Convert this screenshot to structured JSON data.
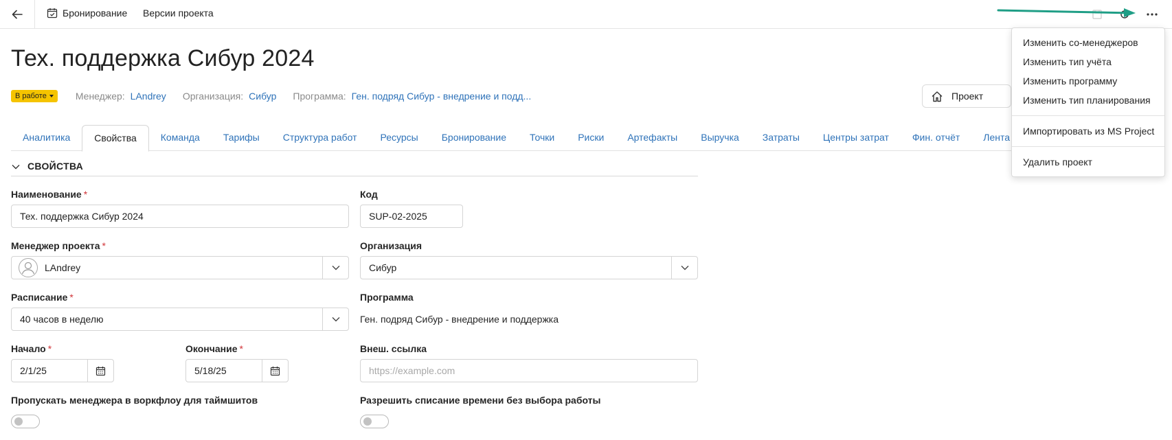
{
  "topbar": {
    "booking_label": "Бронирование",
    "versions_label": "Версии проекта"
  },
  "header": {
    "title": "Тех. поддержка Сибур 2024",
    "status_badge": "В работе",
    "manager_label": "Менеджер:",
    "manager_value": "LAndrey",
    "org_label": "Организация:",
    "org_value": "Сибур",
    "program_label": "Программа:",
    "program_value": "Ген. подряд Сибур - внедрение и подд...",
    "project_button": "Проект"
  },
  "tabs": [
    "Аналитика",
    "Свойства",
    "Команда",
    "Тарифы",
    "Структура работ",
    "Ресурсы",
    "Бронирование",
    "Точки",
    "Риски",
    "Артефакты",
    "Выручка",
    "Затраты",
    "Центры затрат",
    "Фин. отчёт",
    "Лента"
  ],
  "active_tab": "Свойства",
  "section": {
    "title": "СВОЙСТВА"
  },
  "form": {
    "name_label": "Наименование",
    "name_value": "Тех. поддержка Сибур 2024",
    "code_label": "Код",
    "code_value": "SUP-02-2025",
    "manager_label": "Менеджер проекта",
    "manager_value": "LAndrey",
    "org_label": "Организация",
    "org_value": "Сибур",
    "schedule_label": "Расписание",
    "schedule_value": "40 часов в неделю",
    "program_label": "Программа",
    "program_value": "Ген. подряд Сибур - внедрение и поддержка",
    "start_label": "Начало",
    "start_value": "2/1/25",
    "end_label": "Окончание",
    "end_value": "5/18/25",
    "ext_link_label": "Внеш. ссылка",
    "ext_link_placeholder": "https://example.com",
    "skip_manager_label": "Пропускать менеджера в воркфлоу для таймшитов",
    "allow_time_label": "Разрешить списание времени без выбора работы",
    "required_mark": "*"
  },
  "menu": {
    "items_group1": [
      "Изменить со-менеджеров",
      "Изменить тип учёта",
      "Изменить программу",
      "Изменить тип планирования"
    ],
    "items_group2": [
      "Импортировать из MS Project"
    ],
    "items_group3": [
      "Удалить проект"
    ]
  },
  "colors": {
    "link": "#2f73b9",
    "badge": "#f5c400",
    "required": "#d13438",
    "annotation_arrow": "#1f9e86"
  },
  "icons": {
    "back": "arrow-left-icon",
    "calendar": "calendar-check-icon",
    "save": "save-icon",
    "refresh": "refresh-icon",
    "more": "more-horizontal-icon",
    "home": "home-icon",
    "chevron": "chevron-down-icon",
    "date": "calendar-icon"
  }
}
